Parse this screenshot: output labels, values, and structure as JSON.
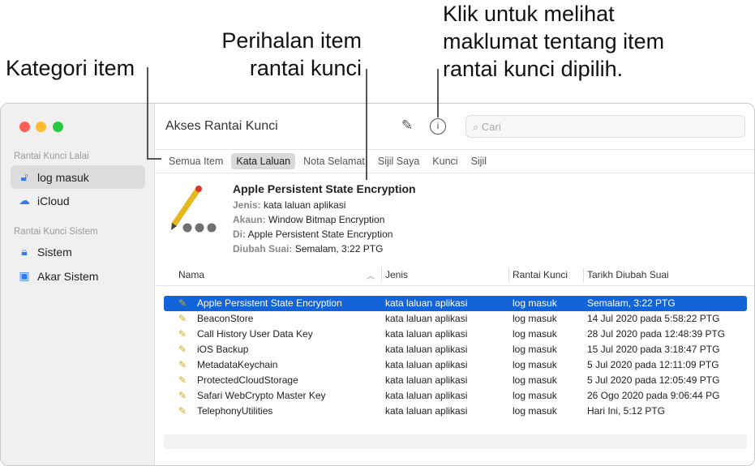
{
  "callouts": {
    "category": "Kategori item",
    "details_1": "Perihalan item",
    "details_2": "rantai kunci",
    "info_1": "Klik untuk melihat",
    "info_2": "maklumat tentang item",
    "info_3": "rantai kunci dipilih."
  },
  "sidebar": {
    "default_section": "Rantai Kunci Lalai",
    "system_section": "Rantai Kunci Sistem",
    "items": [
      {
        "label": "log masuk",
        "icon": "unlocked-lock-icon"
      },
      {
        "label": "iCloud",
        "icon": "cloud-icon"
      },
      {
        "label": "Sistem",
        "icon": "lock-icon"
      },
      {
        "label": "Akar Sistem",
        "icon": "system-root-icon"
      }
    ]
  },
  "header": {
    "title": "Akses Rantai Kunci",
    "search_placeholder": "Cari"
  },
  "tabs": [
    "Semua Item",
    "Kata Laluan",
    "Nota Selamat",
    "Sijil Saya",
    "Kunci",
    "Sijil"
  ],
  "details": {
    "name": "Apple Persistent State Encryption",
    "kind_label": "Jenis:",
    "kind": "kata laluan aplikasi",
    "account_label": "Akaun:",
    "account": "Window Bitmap Encryption",
    "where_label": "Di:",
    "where": "Apple Persistent State Encryption",
    "modified_label": "Diubah Suai:",
    "modified": "Semalam, 3:22 PTG"
  },
  "table": {
    "columns": [
      "Nama",
      "Jenis",
      "Rantai Kunci",
      "Tarikh Diubah Suai"
    ],
    "rows": [
      [
        "Apple Persistent State Encryption",
        "kata laluan aplikasi",
        "log masuk",
        "Semalam, 3:22 PTG"
      ],
      [
        "BeaconStore",
        "kata laluan aplikasi",
        "log masuk",
        "14 Jul 2020 pada 5:58:22 PTG"
      ],
      [
        "Call History User Data Key",
        "kata laluan aplikasi",
        "log masuk",
        "28 Jul 2020 pada 12:48:39 PTG"
      ],
      [
        "iOS Backup",
        "kata laluan aplikasi",
        "log masuk",
        "15 Jul 2020 pada 3:18:47 PTG"
      ],
      [
        "MetadataKeychain",
        "kata laluan aplikasi",
        "log masuk",
        "5 Jul 2020 pada 12:11:09 PTG"
      ],
      [
        "ProtectedCloudStorage",
        "kata laluan aplikasi",
        "log masuk",
        "5 Jul 2020 pada 12:05:49 PTG"
      ],
      [
        "Safari WebCrypto Master Key",
        "kata laluan aplikasi",
        "log masuk",
        "26 Ogo 2020 pada 9:06:44 PG"
      ],
      [
        "TelephonyUtilities",
        "kata laluan aplikasi",
        "log masuk",
        "Hari Ini, 5:12 PTG"
      ]
    ]
  }
}
